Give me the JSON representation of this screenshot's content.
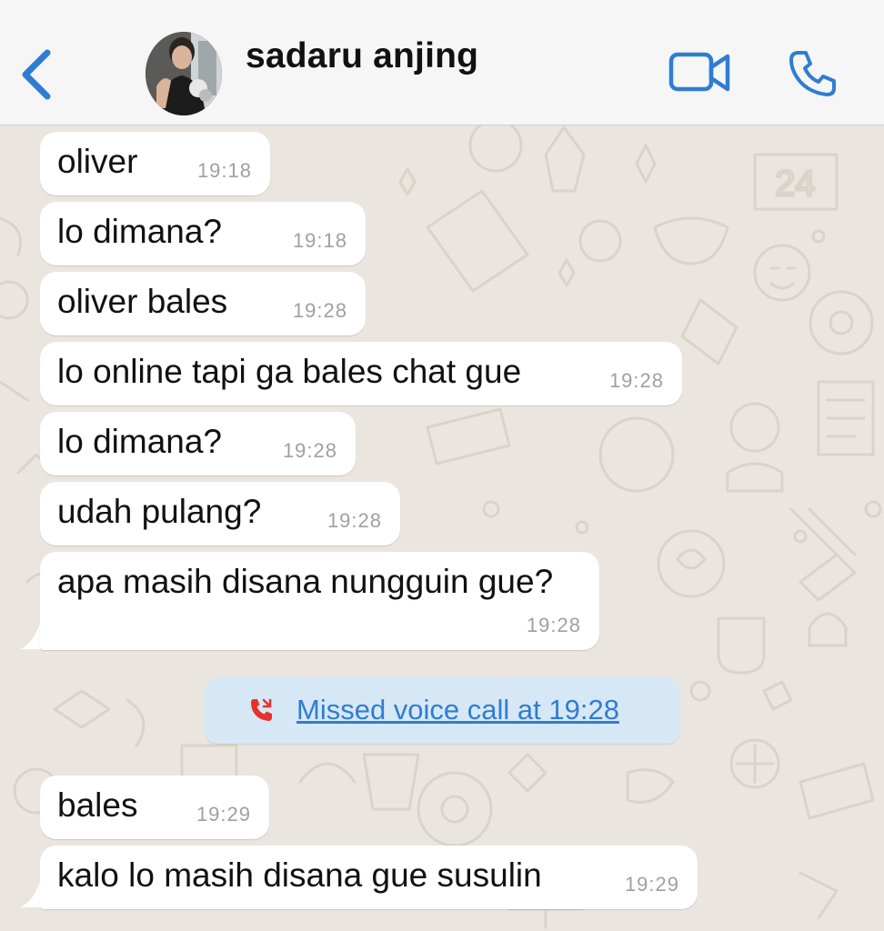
{
  "header": {
    "contact_name": "sadaru anjing",
    "back_icon": "chevron-left-icon",
    "video_icon": "video-camera-icon",
    "call_icon": "phone-icon",
    "accent_color": "#2F7DD2"
  },
  "messages": [
    {
      "text": "oliver",
      "time": "19:18"
    },
    {
      "text": "lo dimana?",
      "time": "19:18"
    },
    {
      "text": "oliver bales",
      "time": "19:28"
    },
    {
      "text": "lo online tapi ga bales chat gue",
      "time": "19:28"
    },
    {
      "text": "lo dimana?",
      "time": "19:28"
    },
    {
      "text": "udah pulang?",
      "time": "19:28"
    },
    {
      "text": "apa masih disana nungguin gue?",
      "time": "19:28"
    },
    {
      "text": "bales",
      "time": "19:29"
    },
    {
      "text": "kalo lo masih disana gue susulin",
      "time": "19:29"
    }
  ],
  "missed_call": {
    "text": "Missed voice call at 19:28",
    "icon": "missed-call-icon",
    "icon_color": "#E5322E"
  },
  "colors": {
    "chat_background": "#EAE6DF",
    "bubble": "#FFFFFF",
    "header": "#F6F6F6"
  }
}
